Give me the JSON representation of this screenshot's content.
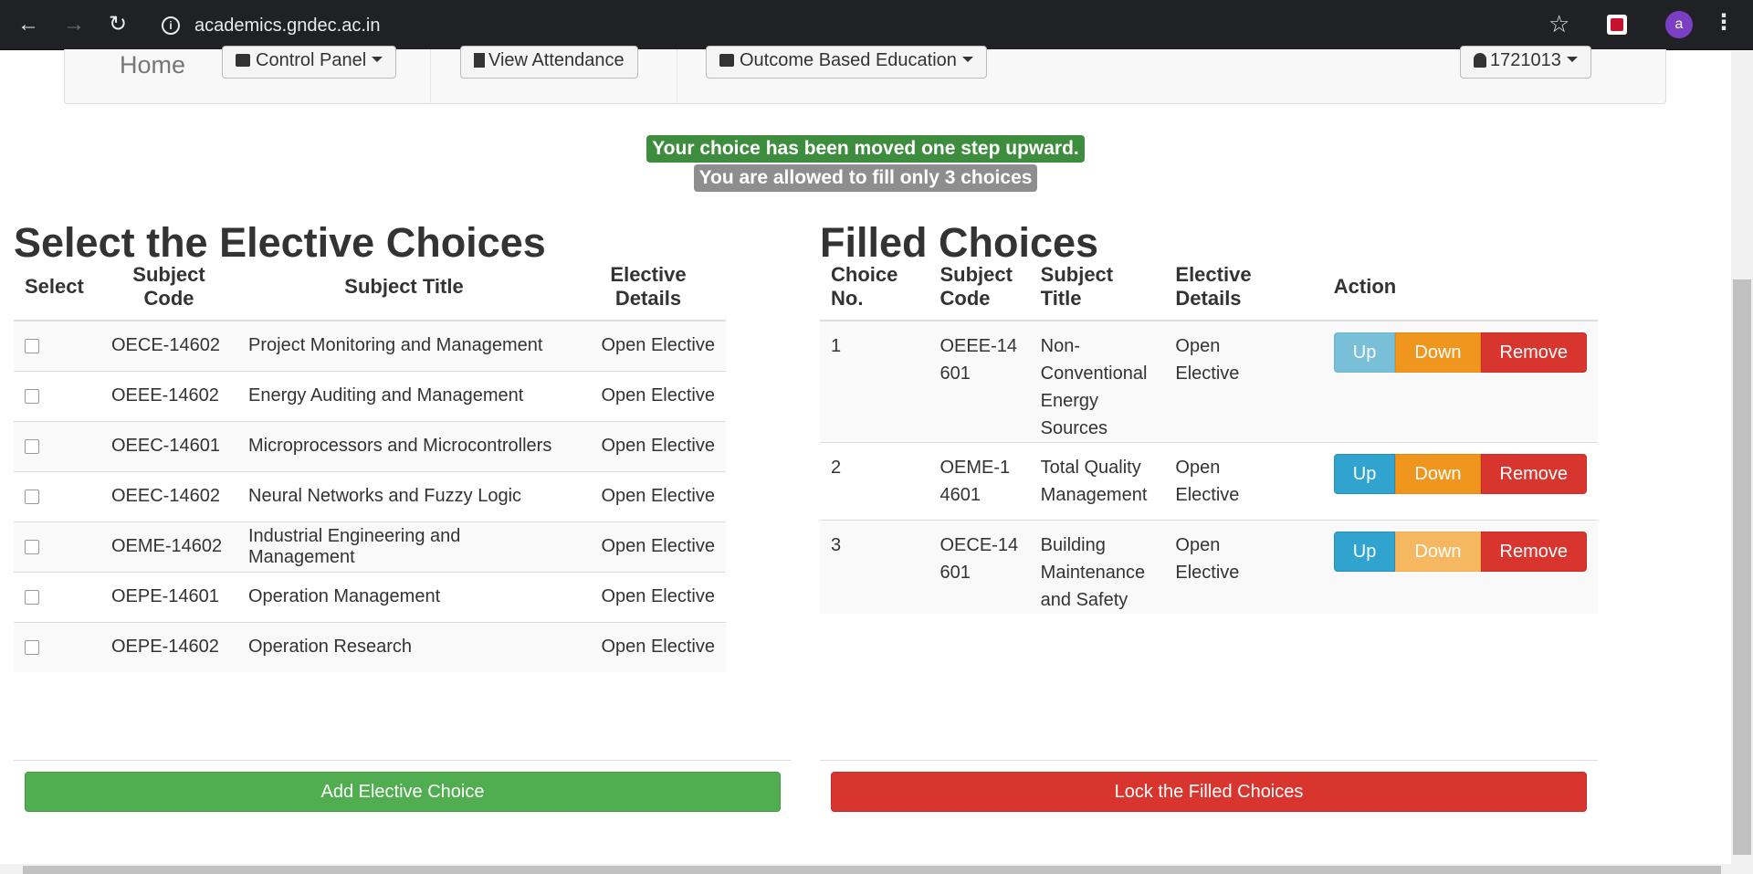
{
  "browser": {
    "url": "academics.gndec.ac.in",
    "avatar_letter": "a"
  },
  "navbar": {
    "home": "Home",
    "control_panel": "Control Panel",
    "view_attendance": "View Attendance",
    "obe": "Outcome Based Education",
    "user": "1721013"
  },
  "alerts": {
    "success": "Your choice has been moved one step upward.",
    "info": "You are allowed to fill only 3 choices"
  },
  "left": {
    "heading": "Select the Elective Choices",
    "columns": [
      "Select",
      "Subject Code",
      "Subject Title",
      "Elective Details"
    ],
    "rows": [
      {
        "code": "OECE-14602",
        "title": "Project Monitoring and Management",
        "details": "Open Elective"
      },
      {
        "code": "OEEE-14602",
        "title": "Energy Auditing and Management",
        "details": "Open Elective"
      },
      {
        "code": "OEEC-14601",
        "title": "Microprocessors and Microcontrollers",
        "details": "Open Elective"
      },
      {
        "code": "OEEC-14602",
        "title": "Neural Networks and Fuzzy Logic",
        "details": "Open Elective"
      },
      {
        "code": "OEME-14602",
        "title": "Industrial Engineering and Management",
        "details": "Open Elective"
      },
      {
        "code": "OEPE-14601",
        "title": "Operation Management",
        "details": "Open Elective"
      },
      {
        "code": "OEPE-14602",
        "title": "Operation Research",
        "details": "Open Elective"
      }
    ],
    "add_button": "Add Elective Choice"
  },
  "right": {
    "heading": "Filled Choices",
    "columns": [
      "Choice No.",
      "Subject Code",
      "Subject Title",
      "Elective Details",
      "Action"
    ],
    "rows": [
      {
        "no": "1",
        "code": "OEEE-14601",
        "title": "Non-Conventional Energy Sources",
        "details": "Open Elective"
      },
      {
        "no": "2",
        "code": "OEME-14601",
        "title": "Total Quality Management",
        "details": "Open Elective"
      },
      {
        "no": "3",
        "code": "OECE-14601",
        "title": "Building Maintenance and Safety",
        "details": "Open Elective"
      }
    ],
    "up_label": "Up",
    "down_label": "Down",
    "remove_label": "Remove",
    "lock_button": "Lock the Filled Choices"
  }
}
